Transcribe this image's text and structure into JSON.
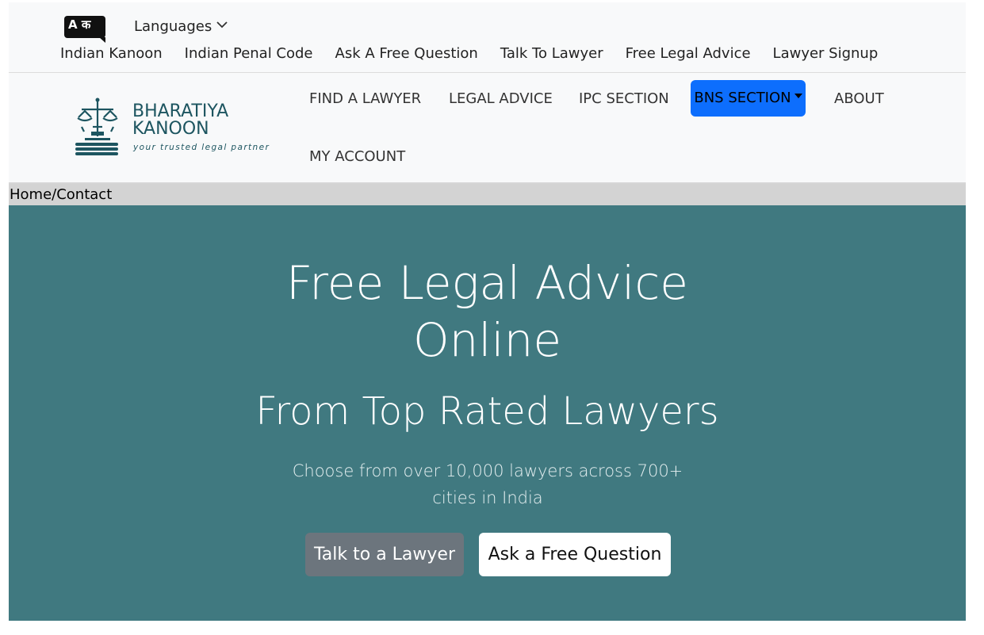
{
  "topbar": {
    "language_badge": "A क",
    "languages_label": "Languages",
    "links": [
      "Indian Kanoon",
      "Indian Penal Code",
      "Ask A Free Question",
      "Talk To Lawyer",
      "Free Legal Advice",
      "Lawyer Signup"
    ]
  },
  "logo": {
    "line1": "BHARATIYA",
    "line2": "KANOON",
    "tagline": "your trusted legal partner",
    "color": "#1d5560"
  },
  "nav": {
    "items": [
      "FIND A LAWYER",
      "LEGAL ADVICE",
      "IPC SECTION",
      "BNS SECTION",
      "ABOUT",
      "MY ACCOUNT"
    ],
    "active_color": "#0d6efd"
  },
  "breadcrumb": "Home/Contact",
  "hero": {
    "title_line1": "Free Legal Advice",
    "title_line2": "Online",
    "subtitle": "From Top Rated Lawyers",
    "description": "Choose from over 10,000 lawyers across 700+ cities in India",
    "primary_button": "Talk to a Lawyer",
    "secondary_button": "Ask a Free Question",
    "background": "#407980"
  }
}
